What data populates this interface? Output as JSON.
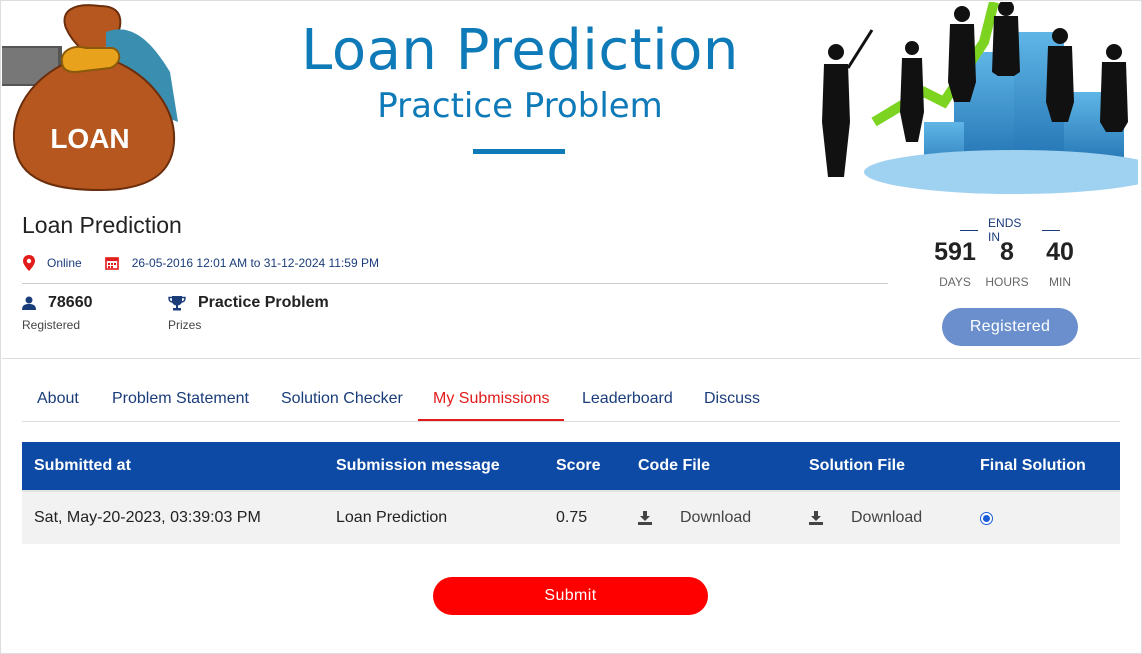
{
  "banner": {
    "title": "Loan Prediction",
    "subtitle": "Practice Problem",
    "bag_label": "LOAN"
  },
  "event": {
    "title": "Loan Prediction",
    "location": "Online",
    "dates": "26-05-2016 12:01 AM to 31-12-2024 11:59 PM",
    "registered_count": "78660",
    "registered_label": "Registered",
    "prize_value": "Practice Problem",
    "prize_label": "Prizes"
  },
  "countdown": {
    "label": "ENDS IN",
    "days": "591",
    "days_label": "DAYS",
    "hours": "8",
    "hours_label": "HOURS",
    "minutes": "40",
    "minutes_label": "MIN"
  },
  "registered_button": "Registered",
  "tabs": [
    {
      "label": "About"
    },
    {
      "label": "Problem Statement"
    },
    {
      "label": "Solution Checker"
    },
    {
      "label": "My Submissions",
      "active": true
    },
    {
      "label": "Leaderboard"
    },
    {
      "label": "Discuss"
    }
  ],
  "table": {
    "headers": [
      "Submitted at",
      "Submission message",
      "Score",
      "Code File",
      "Solution File",
      "Final Solution"
    ],
    "rows": [
      {
        "submitted_at": "Sat, May-20-2023, 03:39:03 PM",
        "message": "Loan Prediction",
        "score": "0.75",
        "code_file": "Download",
        "solution_file": "Download",
        "final_solution": true
      }
    ]
  },
  "submit_button": "Submit",
  "icons": {
    "location": "map-pin-icon",
    "calendar": "calendar-icon",
    "user": "user-icon",
    "trophy": "trophy-icon",
    "download": "download-icon"
  },
  "colors": {
    "brand_blue": "#0d4aa6",
    "banner_blue": "#0f7ab8",
    "accent_red": "#e21b1b",
    "submit_red": "#ff0000",
    "registered_button": "#6a8fcc"
  }
}
